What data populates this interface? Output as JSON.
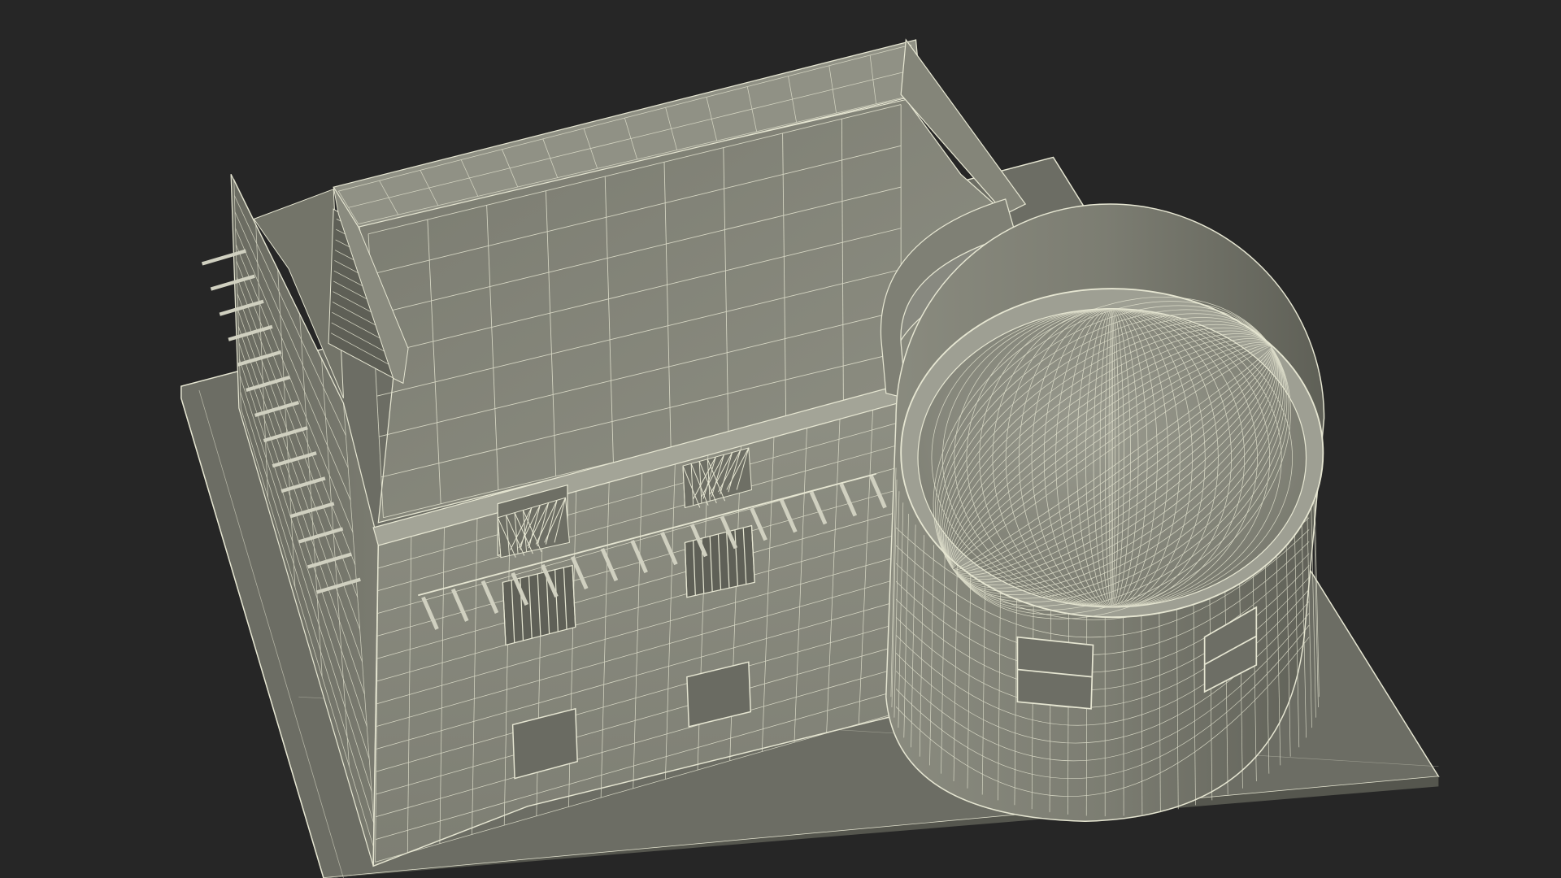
{
  "viewport": {
    "subject": "building-wireframe-render",
    "colors": {
      "background": "#262626",
      "surface_light": "#8b8c80",
      "surface_mid": "#6f7066",
      "surface_dark": "#5a5b52",
      "ground": "#6a6b62",
      "wire": "#e6e6d2"
    }
  }
}
